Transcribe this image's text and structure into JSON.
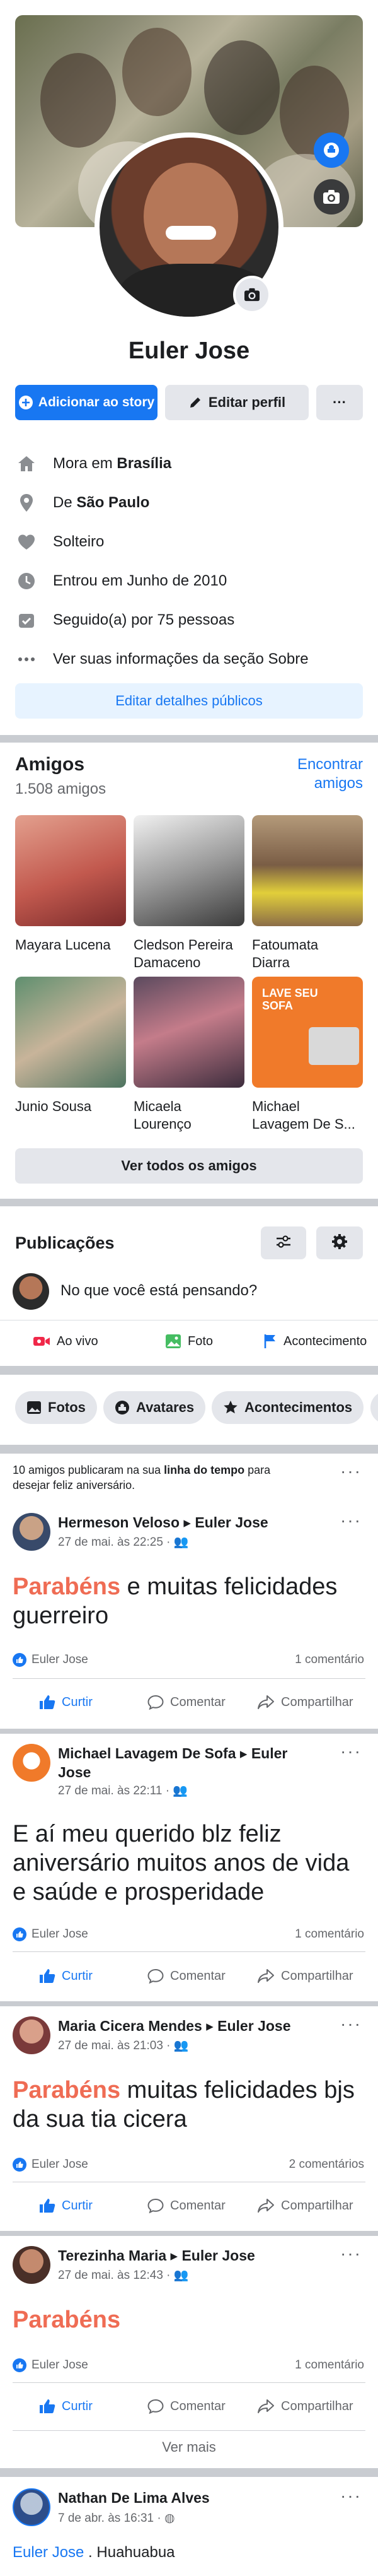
{
  "profile": {
    "name": "Euler Jose",
    "add_story": "Adicionar ao story",
    "edit_profile": "Editar perfil",
    "more": "···"
  },
  "info": {
    "lives_prefix": "Mora em ",
    "lives_city": "Brasília",
    "from_prefix": "De ",
    "from_city": "São Paulo",
    "relationship": "Solteiro",
    "joined": "Entrou em Junho de 2010",
    "followers": "Seguido(a) por 75 pessoas",
    "about": "Ver suas informações da seção Sobre",
    "edit_public": "Editar detalhes públicos"
  },
  "friends": {
    "title": "Amigos",
    "count": "1.508 amigos",
    "find_line1": "Encontrar",
    "find_line2": "amigos",
    "items": [
      {
        "name_line1": "Mayara Lucena",
        "name_line2": ""
      },
      {
        "name_line1": "Cledson Pereira",
        "name_line2": "Damaceno"
      },
      {
        "name_line1": "Fatoumata",
        "name_line2": "Diarra"
      },
      {
        "name_line1": "Junio Sousa",
        "name_line2": ""
      },
      {
        "name_line1": "Micaela",
        "name_line2": "Lourenço"
      },
      {
        "name_line1": "Michael",
        "name_line2": "Lavagem De S..."
      }
    ],
    "see_all": "Ver todos os amigos",
    "sofa_text": "LAVE SEU SOFA"
  },
  "publications": {
    "title": "Publicações",
    "composer_placeholder": "No que você está pensando?",
    "live": "Ao vivo",
    "photo": "Foto",
    "event": "Acontecimento"
  },
  "filters": {
    "photos": "Fotos",
    "avatars": "Avatares",
    "events": "Acontecimentos"
  },
  "birthday_note": {
    "prefix": "10 amigos publicaram na sua ",
    "bold": "linha do tempo",
    "suffix": " para",
    "line2": "desejar feliz aniversário."
  },
  "actions": {
    "like": "Curtir",
    "comment": "Comentar",
    "share": "Compartilhar"
  },
  "posts": [
    {
      "author": "Hermeson Veloso ▸ Euler Jose",
      "meta": "27 de mai. às 22:25 · ",
      "highlight": "Parabéns",
      "text": " e muitas felicidades guerreiro",
      "reactor": "Euler Jose",
      "comments": "1 comentário"
    },
    {
      "author_line1": "Michael Lavagem De Sofa ▸ Euler",
      "author_line2": "Jose",
      "meta": "27 de mai. às 22:11 · ",
      "text": "E aí meu querido blz feliz aniversário muitos anos de vida e saúde e prosperidade",
      "reactor": "Euler Jose",
      "comments": "1 comentário"
    },
    {
      "author": "Maria Cicera Mendes ▸ Euler Jose",
      "meta": "27 de mai. às 21:03 · ",
      "highlight": "Parabéns",
      "text": " muitas felicidades bjs da sua tia cicera",
      "reactor": "Euler Jose",
      "comments": "2 comentários"
    },
    {
      "author": "Terezinha Maria ▸ Euler Jose",
      "meta": "27 de mai. às 12:43 · ",
      "highlight": "Parabéns",
      "reactor": "Euler Jose",
      "comments": "1 comentário"
    }
  ],
  "see_more": "Ver mais",
  "last_post": {
    "author": "Nathan De Lima Alves",
    "meta": "7 de abr. às 16:31 · ",
    "link": "Euler Jose",
    "text": " . Huahuabua"
  },
  "colors": {
    "brand": "#1877f2",
    "highlight": "#ef6c54",
    "secondary_text": "#65676b"
  }
}
